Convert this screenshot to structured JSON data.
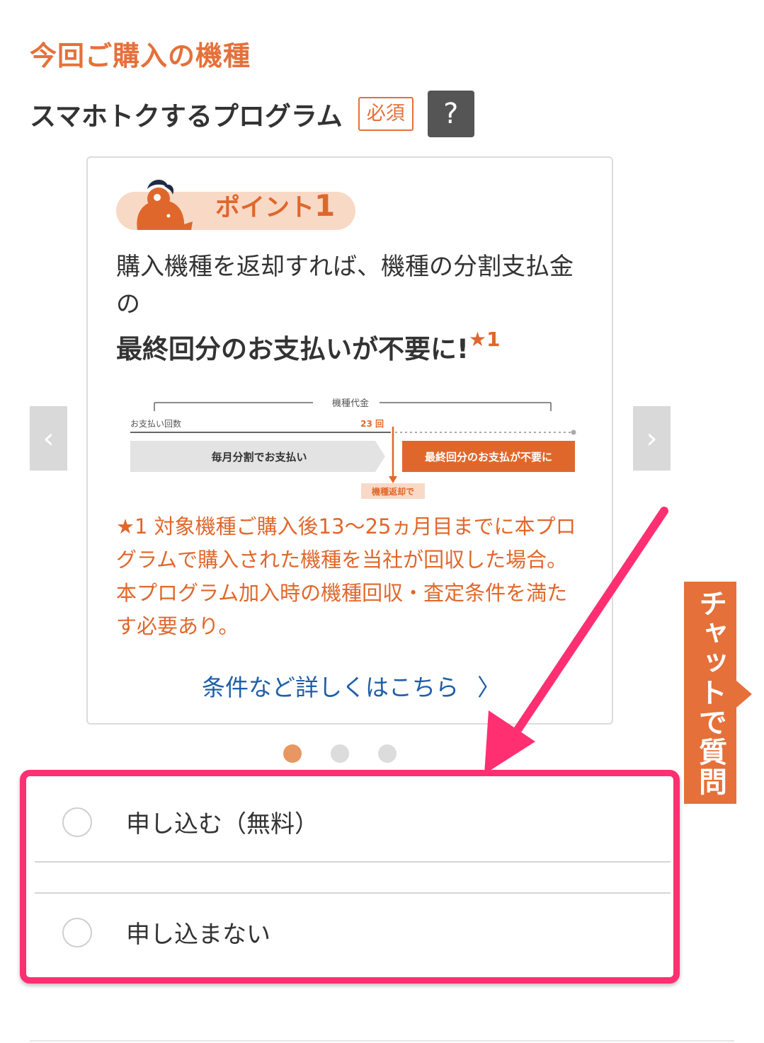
{
  "section_title": "今回ご購入の機種",
  "program": {
    "title": "スマホトクするプログラム",
    "required_badge": "必須",
    "help_icon": "?"
  },
  "card": {
    "point_label": "ポイント",
    "point_number": "1",
    "description": "購入機種を返却すれば、機種の分割支払金の",
    "emphasis": "最終回分のお支払いが不要に!",
    "emphasis_mark": "★1",
    "diagram": {
      "top_label": "機種代金",
      "count_label": "お支払い回数",
      "count_value": "23 回",
      "left_bar": "毎月分割でお支払い",
      "right_bar": "最終回分のお支払が不要に",
      "return_label": "機種返却で"
    },
    "note": "★1 対象機種ご購入後13〜25ヵ月目までに本プログラムで購入された機種を当社が回収した場合。本プログラム加入時の機種回収・査定条件を満たす必要あり。",
    "detail_link": "条件など詳しくはこちら",
    "detail_chevron": "〉"
  },
  "carousel": {
    "prev": "‹",
    "next": "›",
    "active_index": 0,
    "count": 3
  },
  "options": [
    {
      "label": "申し込む（無料）"
    },
    {
      "label": "申し込まない"
    }
  ],
  "chat_tab": {
    "label": "チャットで質問"
  },
  "colors": {
    "accent": "#e5703a",
    "highlight": "#ff2f72",
    "link": "#1f5fa8"
  }
}
